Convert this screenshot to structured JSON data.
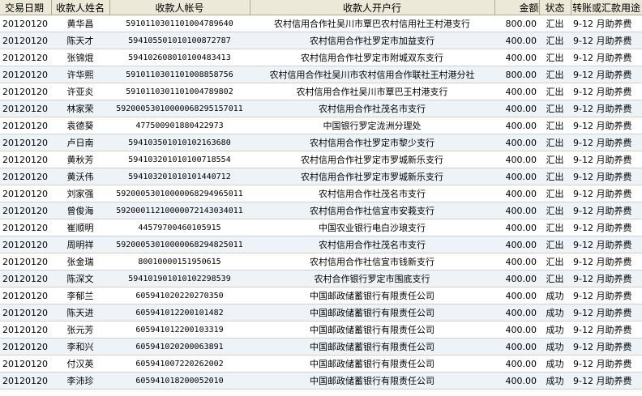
{
  "columns": [
    "交易日期",
    "收款人姓名",
    "收款人帐号",
    "收款人开户行",
    "金额",
    "状态",
    "转账或汇款用途"
  ],
  "rows": [
    [
      "20120120",
      "黄华昌",
      "591011030110100478964​0",
      "农村信用合作社吴川市覃巴农村信用社王村港支行",
      "800.00",
      "汇出",
      "9-12 月助养费"
    ],
    [
      "20120120",
      "陈天才",
      "594105501010100872787",
      "农村信用合作社罗定市加益支行",
      "400.00",
      "汇出",
      "9-12 月助养费"
    ],
    [
      "20120120",
      "张锦焜",
      "594102608010100483413",
      "农村信用合作社罗定市附城双东支行",
      "400.00",
      "汇出",
      "9-12 月助养费"
    ],
    [
      "20120120",
      "许华熙",
      "591011030110100885​8756",
      "农村信用合作社吴川市农村信用合作联社王村港分社",
      "800.00",
      "汇出",
      "9-12 月助养费"
    ],
    [
      "20120120",
      "许亚炎",
      "591011030110100478980​2",
      "农村信用合作社吴川市覃巴王村港支行",
      "400.00",
      "汇出",
      "9-12 月助养费"
    ],
    [
      "20120120",
      "林家荣",
      "592000530100000682951570​11",
      "农村信用合作社茂名市支行",
      "400.00",
      "汇出",
      "9-12 月助养费"
    ],
    [
      "20120120",
      "袁德葵",
      "477500901880422973",
      "中国银行罗定泷洲分理处",
      "400.00",
      "汇出",
      "9-12 月助养费"
    ],
    [
      "20120120",
      "卢日南",
      "594103501010102163680",
      "农村信用合作社罗定市黎少支行",
      "400.00",
      "汇出",
      "9-12 月助养费"
    ],
    [
      "20120120",
      "黄秋芳",
      "594103201010100718554",
      "农村信用合作社罗定市罗城新乐支行",
      "400.00",
      "汇出",
      "9-12 月助养费"
    ],
    [
      "20120120",
      "黄沃伟",
      "594103201010101440712",
      "农村信用合作社罗定市罗城新乐支行",
      "400.00",
      "汇出",
      "9-12 月助养费"
    ],
    [
      "20120120",
      "刘家强",
      "592000530100000682949650​11",
      "农村信用合作社茂名市支行",
      "400.00",
      "汇出",
      "9-12 月助养费"
    ],
    [
      "20120120",
      "曾俊海",
      "592000112100000721430340​11",
      "农村信用合作社信宜市安莪支行",
      "400.00",
      "汇出",
      "9-12 月助养费"
    ],
    [
      "20120120",
      "崔顺明",
      "4457970046010591​5",
      "中国农业银行电白沙琅支行",
      "400.00",
      "汇出",
      "9-12 月助养费"
    ],
    [
      "20120120",
      "周明祥",
      "592000530100000682948250​11",
      "农村信用合作社茂名市支行",
      "400.00",
      "汇出",
      "9-12 月助养费"
    ],
    [
      "20120120",
      "张金瑞",
      "80010000151950615",
      "农村信用合作社信宜市钱新支行",
      "400.00",
      "汇出",
      "9-12 月助养费"
    ],
    [
      "20120120",
      "陈深文",
      "594101901010102298539",
      "农村合作银行罗定市围底支行",
      "400.00",
      "汇出",
      "9-12 月助养费"
    ],
    [
      "20120120",
      "李郁兰",
      "605941020220270350",
      "中国邮政储蓄银行有限责任公司",
      "400.00",
      "成功",
      "9-12 月助养费"
    ],
    [
      "20120120",
      "陈天进",
      "605941012200101482",
      "中国邮政储蓄银行有限责任公司",
      "400.00",
      "成功",
      "9-12 月助养费"
    ],
    [
      "20120120",
      "张元芳",
      "605941012200103319",
      "中国邮政储蓄银行有限责任公司",
      "400.00",
      "成功",
      "9-12 月助养费"
    ],
    [
      "20120120",
      "李和兴",
      "605941020200063891",
      "中国邮政储蓄银行有限责任公司",
      "400.00",
      "成功",
      "9-12 月助养费"
    ],
    [
      "20120120",
      "付汉英",
      "605941007220262002",
      "中国邮政储蓄银行有限责任公司",
      "400.00",
      "成功",
      "9-12 月助养费"
    ],
    [
      "20120120",
      "李沛珍",
      "605941018200052010",
      "中国邮政储蓄银行有限责任公司",
      "400.00",
      "成功",
      "9-12 月助养费"
    ]
  ]
}
